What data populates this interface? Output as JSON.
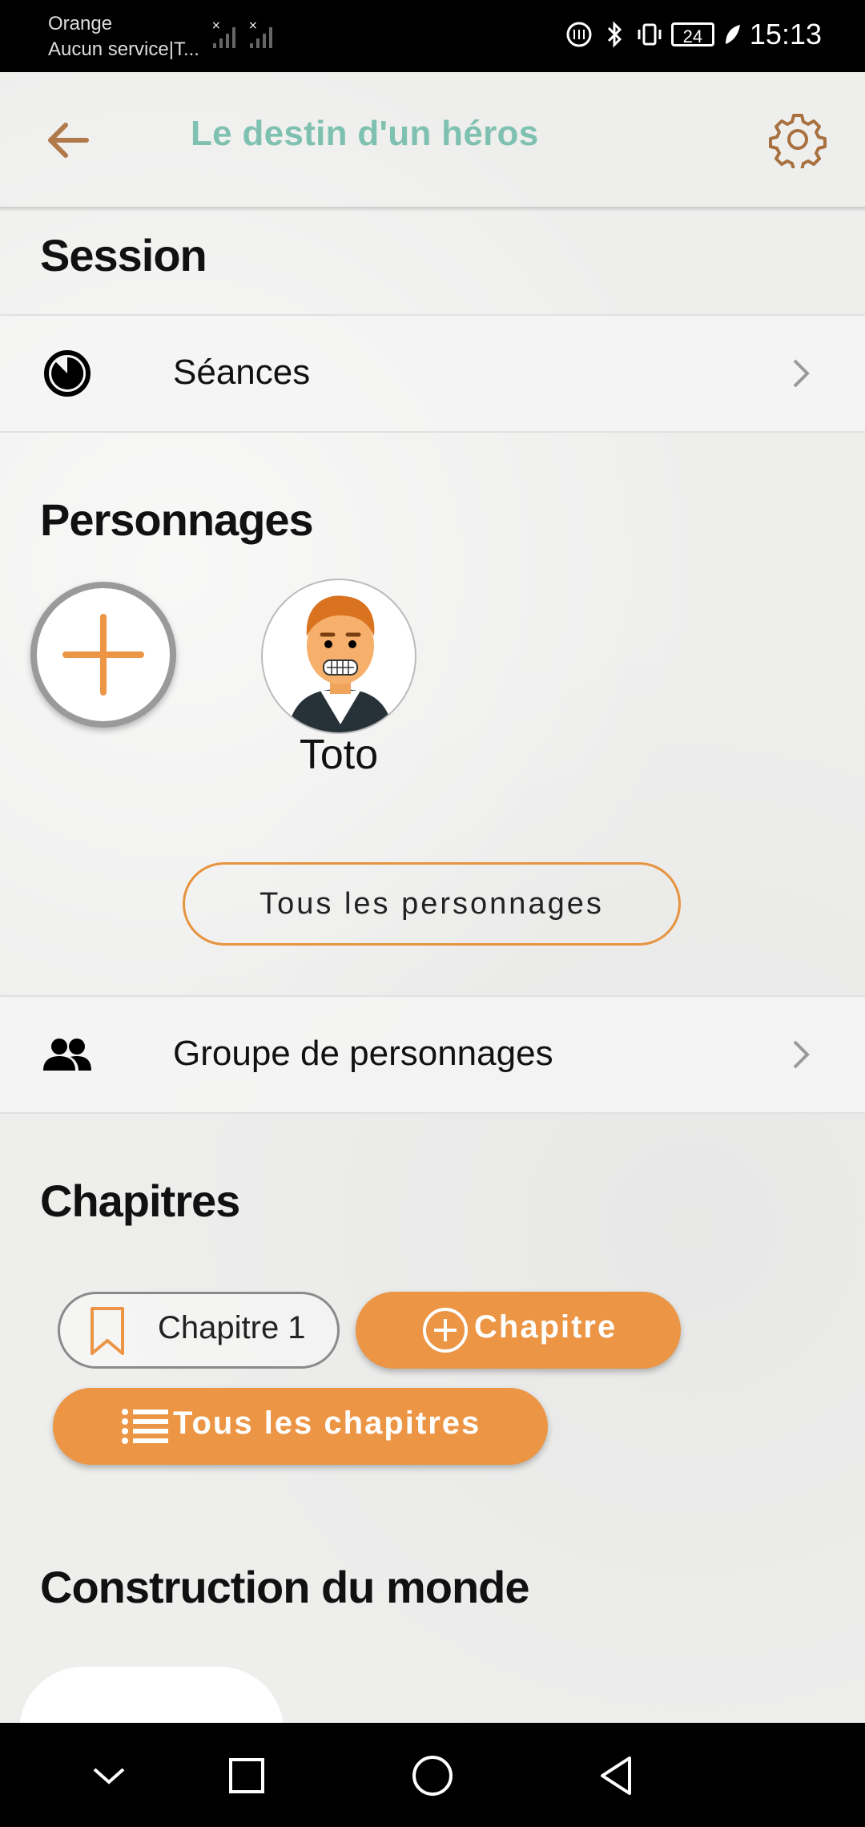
{
  "status_bar": {
    "carrier": "Orange",
    "service": "Aucun service|T...",
    "battery": "24",
    "time": "15:13"
  },
  "app_bar": {
    "title": "Le destin d'un héros"
  },
  "session": {
    "title": "Session",
    "seances_label": "Séances"
  },
  "personnages": {
    "title": "Personnages",
    "characters": [
      {
        "name": "Toto"
      }
    ],
    "all_button": "Tous les personnages",
    "group_label": "Groupe de personnages"
  },
  "chapitres": {
    "title": "Chapitres",
    "chips": [
      {
        "label": "Chapitre 1"
      }
    ],
    "add_button": "Chapitre",
    "all_button": "Tous les chapitres"
  },
  "world": {
    "title": "Construction du monde"
  },
  "colors": {
    "accent": "#eb9545",
    "title_teal": "#7fc1b0",
    "back_arrow": "#b07a4a"
  }
}
